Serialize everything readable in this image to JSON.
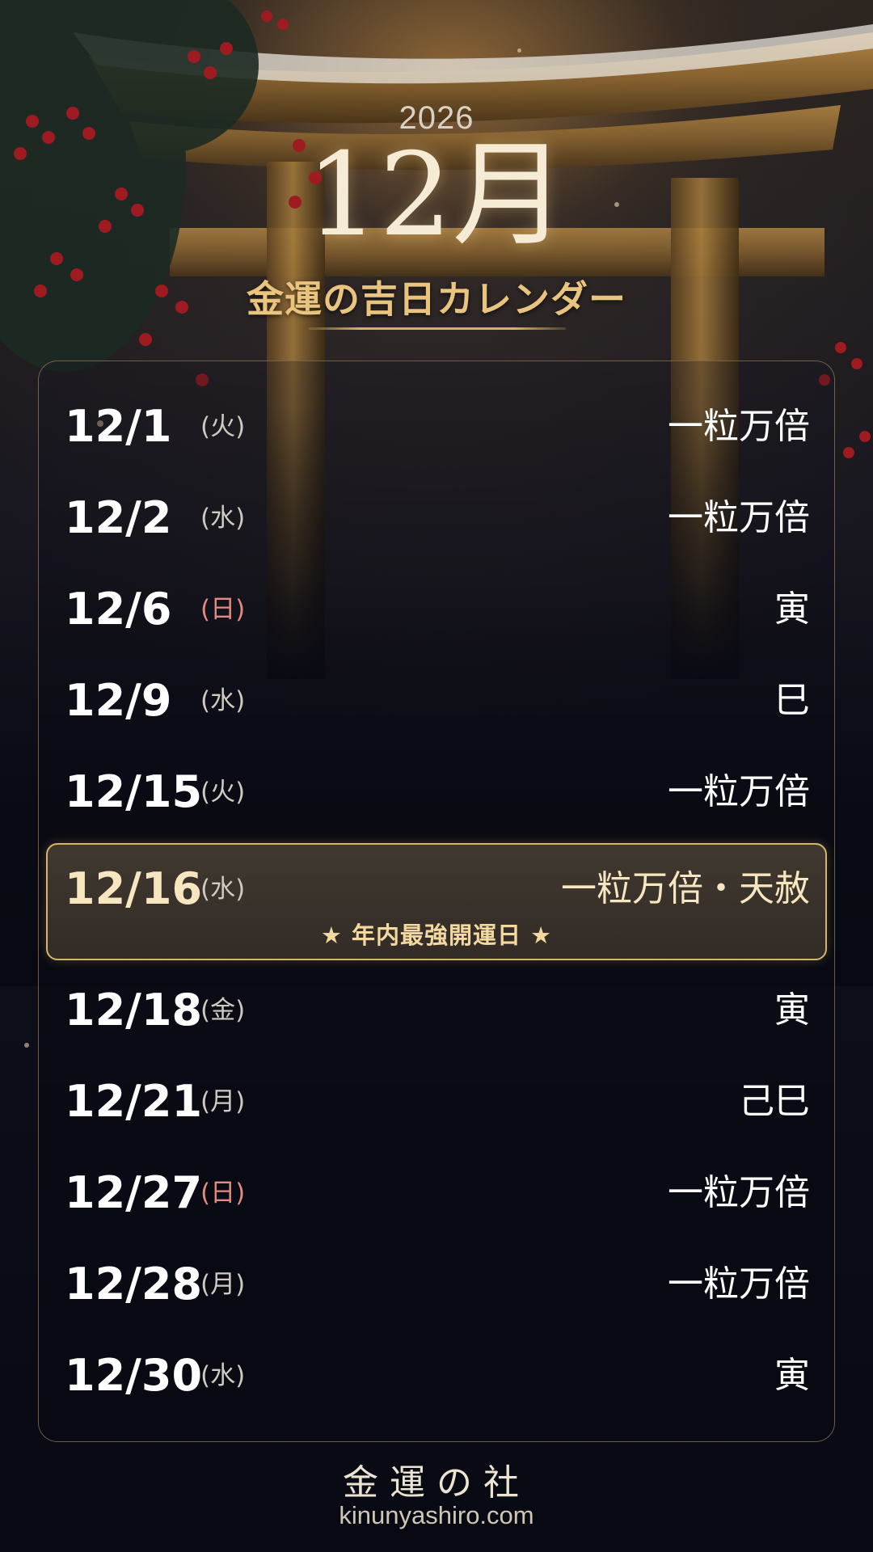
{
  "header": {
    "year": "2026",
    "month": "12月",
    "subtitle": "金運の吉日カレンダー"
  },
  "days": [
    {
      "date": "12/1",
      "dow": "(火)",
      "luck": "一粒万倍"
    },
    {
      "date": "12/2",
      "dow": "(水)",
      "luck": "一粒万倍"
    },
    {
      "date": "12/6",
      "dow": "(日)",
      "luck": "寅"
    },
    {
      "date": "12/9",
      "dow": "(水)",
      "luck": "巳"
    },
    {
      "date": "12/15",
      "dow": "(火)",
      "luck": "一粒万倍"
    },
    {
      "date": "12/16",
      "dow": "(水)",
      "luck": "一粒万倍・天赦"
    },
    {
      "date": "12/18",
      "dow": "(金)",
      "luck": "寅"
    },
    {
      "date": "12/21",
      "dow": "(月)",
      "luck": "己巳"
    },
    {
      "date": "12/27",
      "dow": "(日)",
      "luck": "一粒万倍"
    },
    {
      "date": "12/28",
      "dow": "(月)",
      "luck": "一粒万倍"
    },
    {
      "date": "12/30",
      "dow": "(水)",
      "luck": "寅"
    }
  ],
  "highlight_note": "★ 年内最強開運日 ★",
  "footer": {
    "brand": "金運の社",
    "url": "kinunyashiro.com"
  },
  "colors": {
    "accent_gold": "#d7b46b",
    "sunday_red": "#e58a80",
    "background": "#0a0b14"
  }
}
